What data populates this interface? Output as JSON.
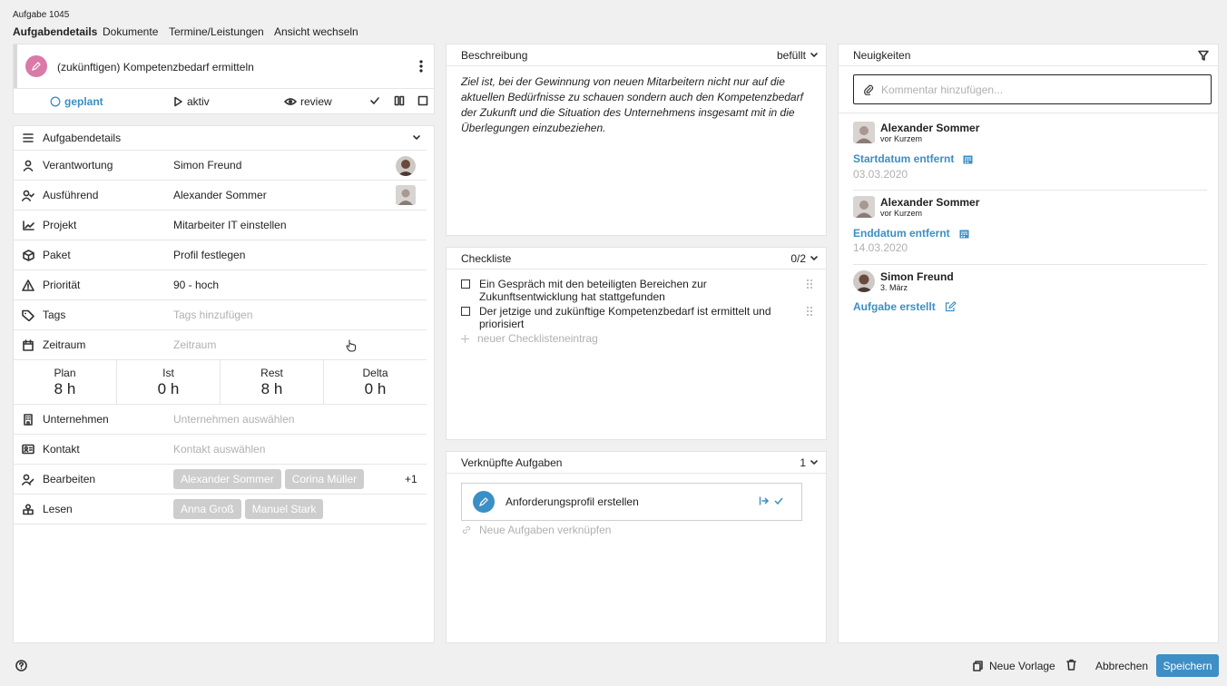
{
  "page": {
    "task_id": "Aufgabe 1045",
    "tabs": [
      "Aufgabendetails",
      "Dokumente",
      "Termine/Leistungen",
      "Ansicht wechseln"
    ]
  },
  "task": {
    "title": "(zukünftigen) Kompetenzbedarf ermitteln",
    "status_planned": "geplant",
    "status_active": "aktiv",
    "status_review": "review"
  },
  "details": {
    "header": "Aufgabendetails",
    "rows": {
      "responsible": {
        "label": "Verantwortung",
        "value": "Simon Freund"
      },
      "executing": {
        "label": "Ausführend",
        "value": "Alexander Sommer"
      },
      "project": {
        "label": "Projekt",
        "value": "Mitarbeiter IT einstellen"
      },
      "package": {
        "label": "Paket",
        "value": "Profil festlegen"
      },
      "priority": {
        "label": "Priorität",
        "value": "90 - hoch"
      },
      "tags": {
        "label": "Tags",
        "placeholder": "Tags hinzufügen"
      },
      "period": {
        "label": "Zeitraum",
        "placeholder": "Zeitraum"
      },
      "company": {
        "label": "Unternehmen",
        "placeholder": "Unternehmen auswählen"
      },
      "contact": {
        "label": "Kontakt",
        "placeholder": "Kontakt auswählen"
      },
      "edit": {
        "label": "Bearbeiten",
        "chips": [
          "Alexander Sommer",
          "Corina Müller"
        ],
        "more": "+1"
      },
      "read": {
        "label": "Lesen",
        "chips": [
          "Anna Groß",
          "Manuel Stark"
        ]
      }
    },
    "hours": [
      {
        "label": "Plan",
        "value": "8 h"
      },
      {
        "label": "Ist",
        "value": "0 h"
      },
      {
        "label": "Rest",
        "value": "8 h"
      },
      {
        "label": "Delta",
        "value": "0 h"
      }
    ]
  },
  "description": {
    "header": "Beschreibung",
    "state": "befüllt",
    "text": "Ziel ist, bei der Gewinnung von neuen Mitarbeitern nicht nur auf die aktuellen Bedürfnisse zu schauen sondern auch den Kompetenzbedarf der Zukunft und die Situation des Unternehmens insgesamt mit in die Überlegungen einzubeziehen."
  },
  "checklist": {
    "header": "Checkliste",
    "count": "0/2",
    "items": [
      "Ein Gespräch mit den beteiligten Bereichen zur Zukunftsentwicklung hat stattgefunden",
      "Der jetzige und zukünftige Kompetenzbedarf ist ermittelt und priorisiert"
    ],
    "new_entry": "neuer Checklisteneintrag"
  },
  "linked": {
    "header": "Verknüpfte Aufgaben",
    "count": "1",
    "task": "Anforderungsprofil erstellen",
    "new_link": "Neue Aufgaben verknüpfen"
  },
  "news": {
    "header": "Neuigkeiten",
    "comment_placeholder": "Kommentar hinzufügen...",
    "entries": [
      {
        "name": "Alexander Sommer",
        "time": "vor Kurzem",
        "action": "Startdatum entfernt",
        "date": "03.03.2020"
      },
      {
        "name": "Alexander Sommer",
        "time": "vor Kurzem",
        "action": "Enddatum entfernt",
        "date": "14.03.2020"
      },
      {
        "name": "Simon Freund",
        "time": "3. März",
        "action": "Aufgabe erstellt",
        "date": ""
      }
    ]
  },
  "footer": {
    "new_template": "Neue Vorlage",
    "cancel": "Abbrechen",
    "save": "Speichern"
  },
  "colors": {
    "accent": "#3b8fc4",
    "pink": "#d97aa8",
    "save": "#3d8fc6"
  }
}
